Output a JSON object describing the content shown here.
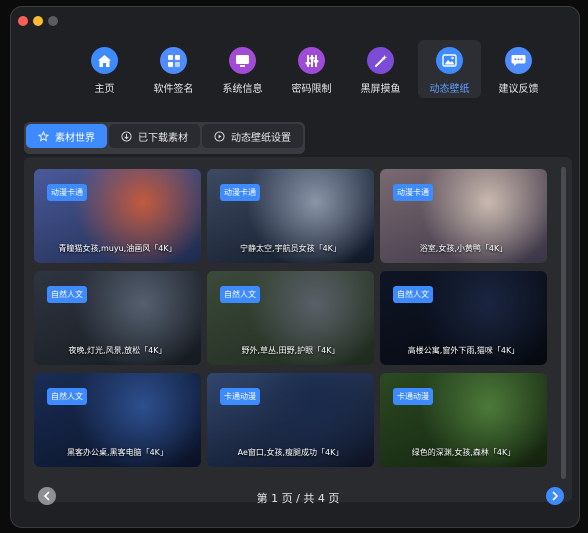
{
  "window": {
    "controls": [
      "close",
      "minimize",
      "zoom"
    ]
  },
  "nav": [
    {
      "label": "主页",
      "icon": "home-icon",
      "color": "#3d8bff"
    },
    {
      "label": "软件签名",
      "icon": "app-signature-icon",
      "color": "#4f8cff"
    },
    {
      "label": "系统信息",
      "icon": "monitor-icon",
      "color": "#a24bd6"
    },
    {
      "label": "密码限制",
      "icon": "sliders-icon",
      "color": "#a04bd8"
    },
    {
      "label": "黑屏摸鱼",
      "icon": "magic-wand-icon",
      "color": "#7d4cd6"
    },
    {
      "label": "动态壁纸",
      "icon": "image-mountain-icon",
      "color": "#3d8bff",
      "active": true
    },
    {
      "label": "建议反馈",
      "icon": "chat-bubble-icon",
      "color": "#4f8cff"
    }
  ],
  "tabs": [
    {
      "label": "素材世界",
      "icon": "star-icon",
      "active": true
    },
    {
      "label": "已下载素材",
      "icon": "download-icon"
    },
    {
      "label": "动态壁纸设置",
      "icon": "play-icon"
    }
  ],
  "cards": [
    {
      "badge": "动漫卡通",
      "caption": "青瞳猫女孩,muyu,油画风「4K」",
      "colors": [
        "#c25a3d",
        "#4a5a9a",
        "#1e2a4d"
      ]
    },
    {
      "badge": "动漫卡通",
      "caption": "宁静太空,宇航员女孩「4K」",
      "colors": [
        "#8a95a8",
        "#3d4a62",
        "#101826"
      ]
    },
    {
      "badge": "动漫卡通",
      "caption": "浴室,女孩,小黄鸭「4K」",
      "colors": [
        "#c9b9b0",
        "#7a6a70",
        "#3a3546"
      ]
    },
    {
      "badge": "自然人文",
      "caption": "夜晚,灯光,风景,放松「4K」",
      "colors": [
        "#556070",
        "#2f3540",
        "#161a20"
      ]
    },
    {
      "badge": "自然人文",
      "caption": "野外,草丛,田野,护眼「4K」",
      "colors": [
        "#5a6068",
        "#3b4a3a",
        "#1f2a1e"
      ]
    },
    {
      "badge": "自然人文",
      "caption": "高楼公寓,窗外下雨,猫咪「4K」",
      "colors": [
        "#1a2540",
        "#0f1526",
        "#06090f"
      ]
    },
    {
      "badge": "自然人文",
      "caption": "黑客办公桌,黑客电脑「4K」",
      "colors": [
        "#2d4f8f",
        "#1a2d55",
        "#0a1226"
      ]
    },
    {
      "badge": "卡通动漫",
      "caption": "Ae窗口,女孩,瘦腿成功「4K」",
      "colors": [
        "#1a2a4a",
        "#31466e",
        "#0c1222"
      ]
    },
    {
      "badge": "卡通动漫",
      "caption": "绿色的深渊,女孩,森林「4K」",
      "colors": [
        "#4d7a3a",
        "#2b4a22",
        "#13220e"
      ]
    }
  ],
  "pager": {
    "text": "第 1 页 / 共 4 页"
  }
}
